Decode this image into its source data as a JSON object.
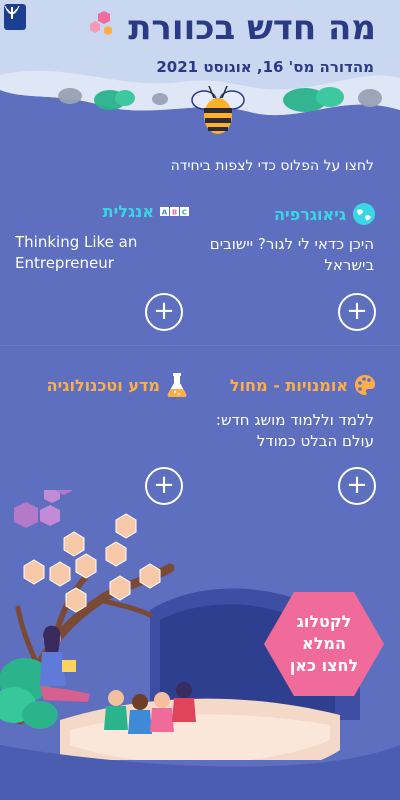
{
  "header": {
    "title": "מה חדש בכוורת",
    "subtitle": "מהדורה מס' 16, אוגוסט 2021"
  },
  "instructions": "לחצו על הפלוס כדי לצפות ביחידה",
  "subjects": [
    {
      "title": "גיאוגרפיה",
      "description": "היכן כדאי לי לגור? יישובים בישראל",
      "icon": "globe-icon",
      "color": "#3ad6e6"
    },
    {
      "title": "אנגלית",
      "description": "Thinking Like an Entrepreneur",
      "icon": "abc-blocks-icon",
      "color": "#3ad6e6"
    },
    {
      "title": "אומנויות - מחול",
      "description": "ללמד וללמוד מושג חדש: עולם הבלט כמודל",
      "icon": "palette-icon",
      "color": "#ffae47"
    },
    {
      "title": "מדע וטכנולוגיה",
      "description": "",
      "icon": "flask-icon",
      "color": "#ffae47"
    }
  ],
  "plus_symbol": "+",
  "catalog": {
    "label": "לקטלוג\nהמלא\nלחצו כאן",
    "color": "#f06a9a"
  },
  "colors": {
    "background": "#5d6fbe",
    "hero": "#c9d7f0",
    "title": "#2a3a84"
  }
}
